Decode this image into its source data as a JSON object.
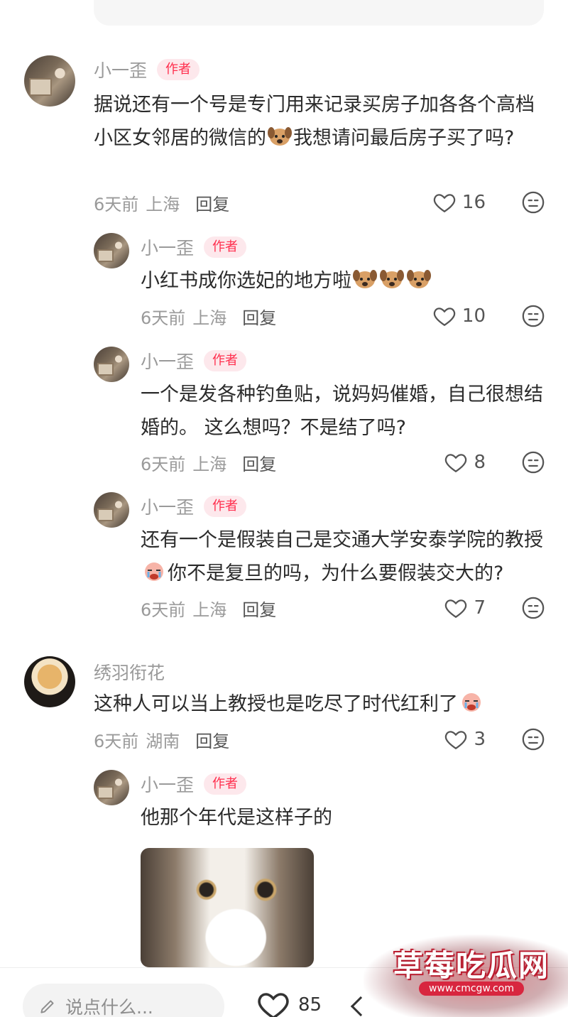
{
  "comments": [
    {
      "name": "小一歪",
      "badge": "作者",
      "text_a": "据说还有一个号是专门用来记录买房子加各各个高档小区女邻居的微信的",
      "text_b": "我想请问最后房子买了吗?",
      "time": "6天前",
      "location": "上海",
      "reply": "回复",
      "likes": "16",
      "replies": [
        {
          "name": "小一歪",
          "badge": "作者",
          "text": "小红书成你选妃的地方啦",
          "time": "6天前",
          "location": "上海",
          "reply": "回复",
          "likes": "10"
        },
        {
          "name": "小一歪",
          "badge": "作者",
          "text": "一个是发各种钓鱼贴，说妈妈催婚，自己很想结婚的。 这么想吗？不是结了吗?",
          "time": "6天前",
          "location": "上海",
          "reply": "回复",
          "likes": "8"
        },
        {
          "name": "小一歪",
          "badge": "作者",
          "text_a": "还有一个是假装自己是交通大学安泰学院的教授",
          "text_b": "你不是复旦的吗，为什么要假装交大的?",
          "time": "6天前",
          "location": "上海",
          "reply": "回复",
          "likes": "7"
        }
      ]
    },
    {
      "name": "绣羽衔花",
      "text": "这种人可以当上教授也是吃尽了时代红利了",
      "time": "6天前",
      "location": "湖南",
      "reply": "回复",
      "likes": "3",
      "replies": [
        {
          "name": "小一歪",
          "badge": "作者",
          "text": "他那个年代是这样子的"
        }
      ]
    }
  ],
  "bottom_bar": {
    "input_placeholder": "说点什么...",
    "likes": "85"
  },
  "watermark": {
    "title": "草莓吃瓜网",
    "url": "www.cmcgw.com"
  },
  "icons": {
    "like": "heart-outline-icon",
    "dislike": "meh-face-icon",
    "edit": "pencil-icon"
  }
}
